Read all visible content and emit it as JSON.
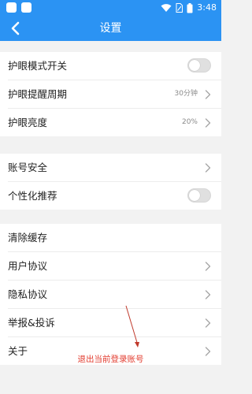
{
  "status_bar": {
    "time": "3:48",
    "left_icons": [
      "app-icon",
      "app-icon"
    ],
    "right_icons": [
      "wifi-icon",
      "sim-icon",
      "battery-icon"
    ]
  },
  "header": {
    "back_icon": "chevron-left-icon",
    "title": "设置"
  },
  "groups": [
    {
      "items": [
        {
          "label": "护眼模式开关",
          "control": "toggle",
          "on": false
        },
        {
          "label": "护眼提醒周期",
          "value": "30分钟",
          "control": "chevron"
        },
        {
          "label": "护眼亮度",
          "value": "20%",
          "control": "chevron"
        }
      ]
    },
    {
      "items": [
        {
          "label": "账号安全",
          "control": "chevron"
        },
        {
          "label": "个性化推荐",
          "control": "toggle",
          "on": false
        }
      ]
    },
    {
      "items": [
        {
          "label": "清除缓存",
          "control": "none"
        },
        {
          "label": "用户协议",
          "control": "chevron"
        },
        {
          "label": "隐私协议",
          "control": "chevron"
        },
        {
          "label": "举报&投诉",
          "control": "chevron"
        },
        {
          "label": "关于",
          "control": "chevron"
        }
      ]
    }
  ],
  "logout_label": "退出当前登录账号",
  "colors": {
    "header_bg": "#2b93f3",
    "logout_text": "#e23b2e",
    "page_bg": "#f2f2f2"
  }
}
